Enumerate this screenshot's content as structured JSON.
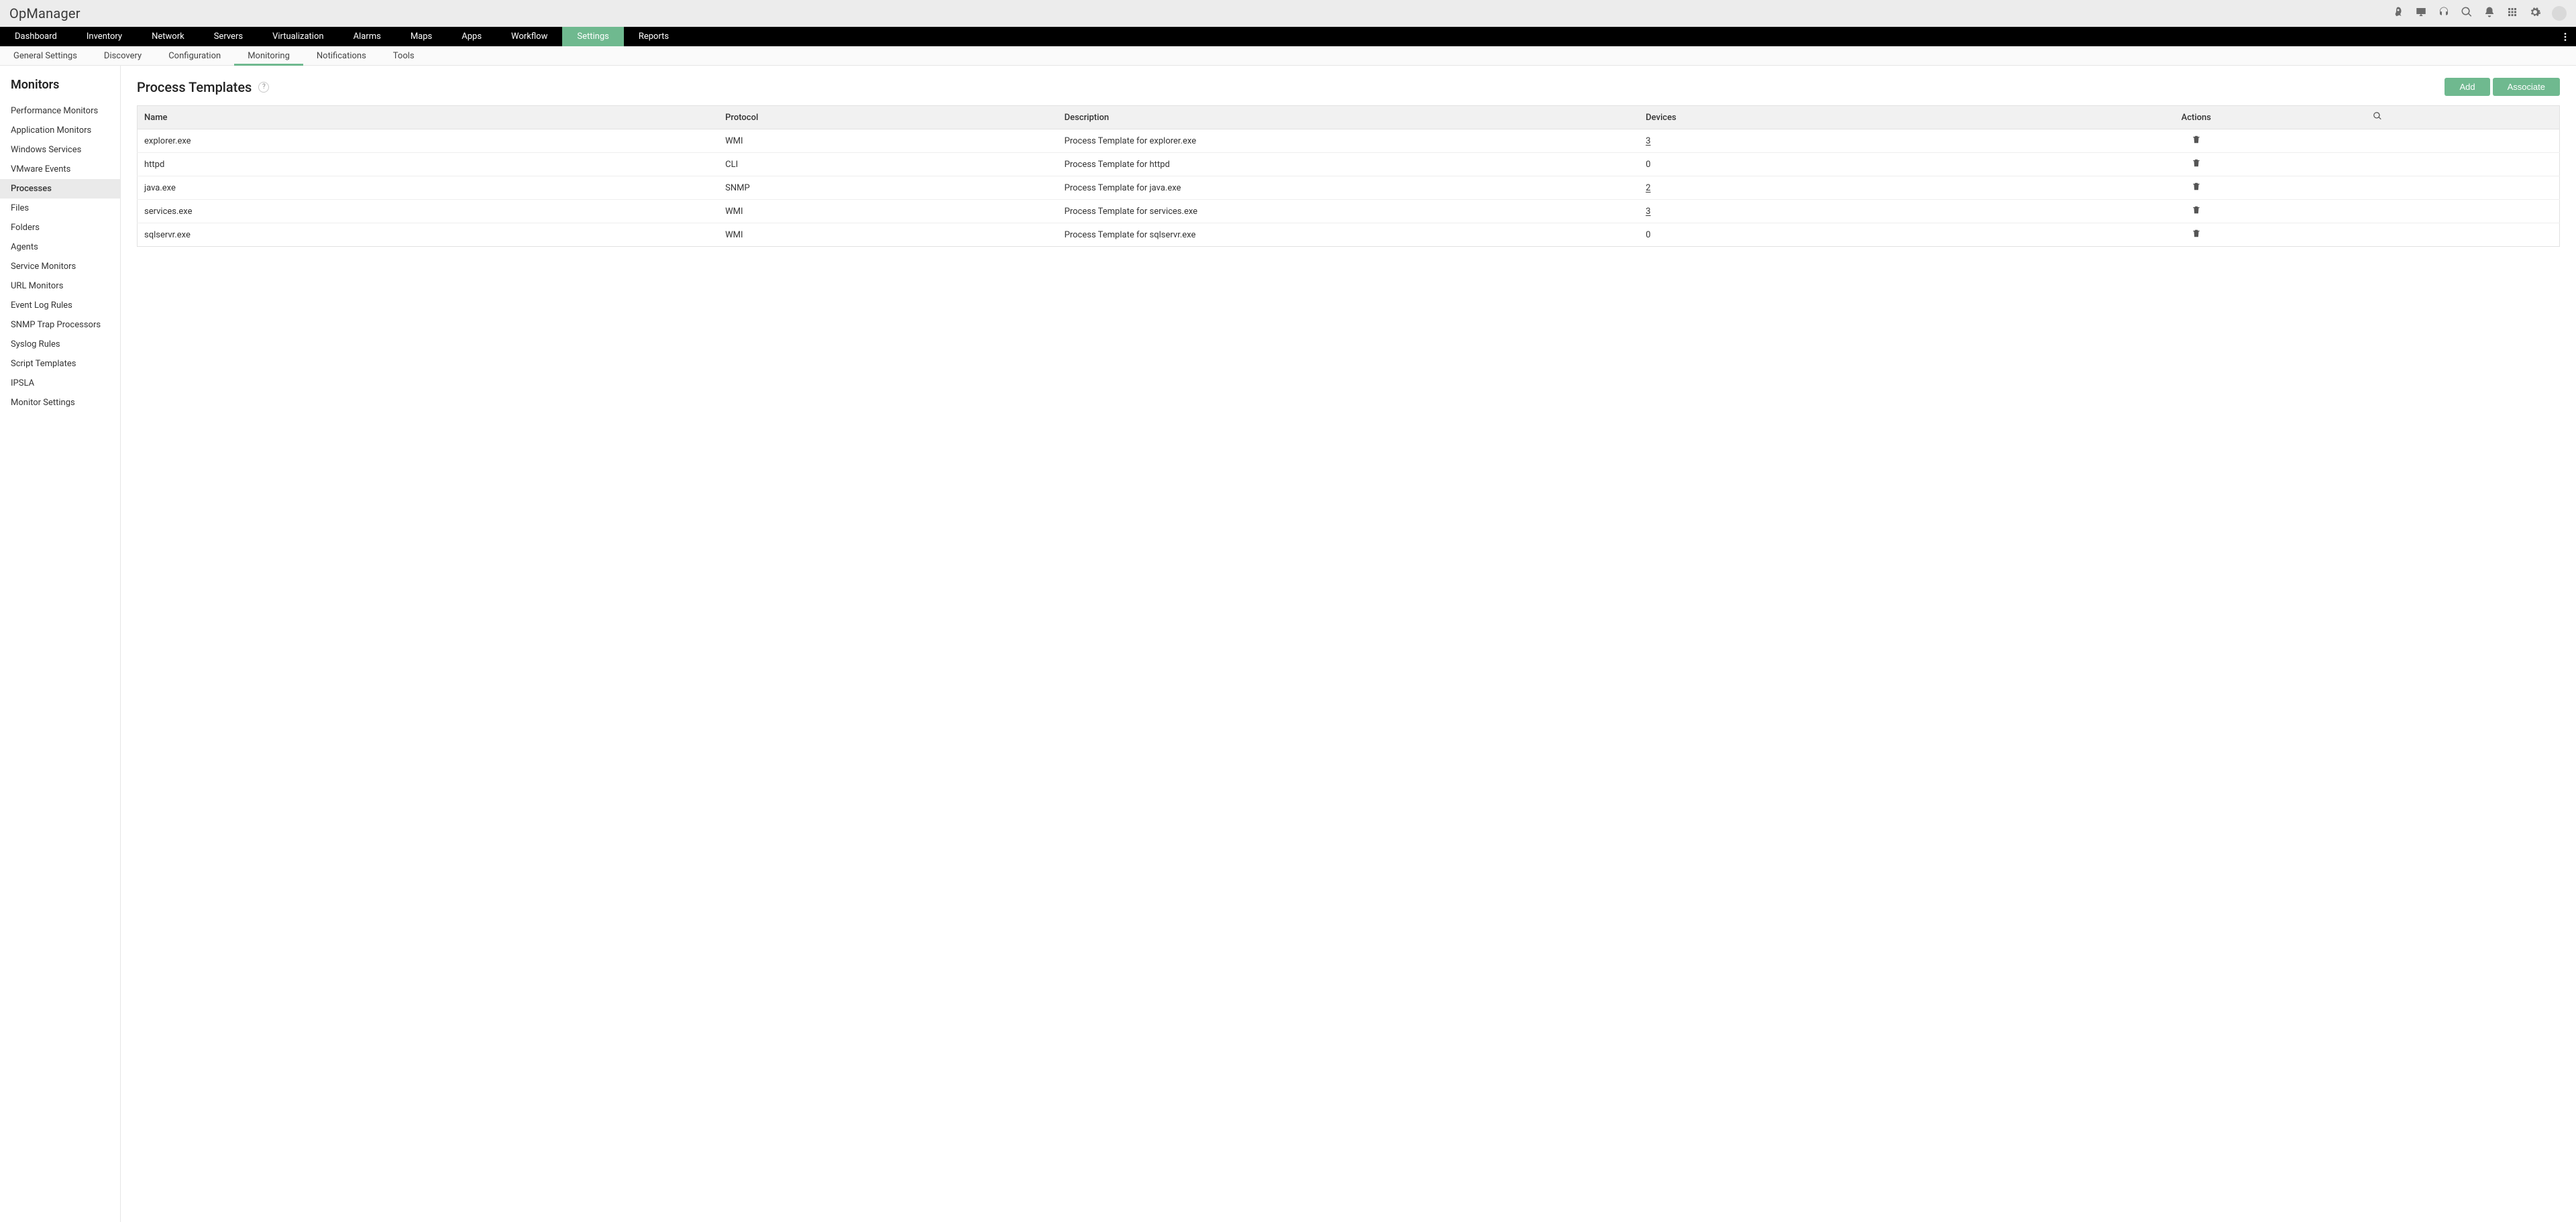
{
  "brand": "OpManager",
  "topIcons": [
    "rocket",
    "monitor",
    "headset",
    "search",
    "bell",
    "apps",
    "gear",
    "avatar"
  ],
  "primaryNav": {
    "items": [
      "Dashboard",
      "Inventory",
      "Network",
      "Servers",
      "Virtualization",
      "Alarms",
      "Maps",
      "Apps",
      "Workflow",
      "Settings",
      "Reports"
    ],
    "activeIndex": 9
  },
  "secondaryNav": {
    "items": [
      "General Settings",
      "Discovery",
      "Configuration",
      "Monitoring",
      "Notifications",
      "Tools"
    ],
    "activeIndex": 3
  },
  "sidebar": {
    "heading": "Monitors",
    "items": [
      "Performance Monitors",
      "Application Monitors",
      "Windows Services",
      "VMware Events",
      "Processes",
      "Files",
      "Folders",
      "Agents",
      "Service Monitors",
      "URL Monitors",
      "Event Log Rules",
      "SNMP Trap Processors",
      "Syslog Rules",
      "Script Templates",
      "IPSLA",
      "Monitor Settings"
    ],
    "activeIndex": 4
  },
  "page": {
    "title": "Process Templates",
    "help": "?",
    "buttons": {
      "add": "Add",
      "associate": "Associate"
    }
  },
  "table": {
    "columns": [
      "Name",
      "Protocol",
      "Description",
      "Devices",
      "Actions"
    ],
    "rows": [
      {
        "name": "explorer.exe",
        "protocol": "WMI",
        "description": "Process Template for explorer.exe",
        "devices": "3",
        "devicesLink": true
      },
      {
        "name": "httpd",
        "protocol": "CLI",
        "description": "Process Template for httpd",
        "devices": "0",
        "devicesLink": false
      },
      {
        "name": "java.exe",
        "protocol": "SNMP",
        "description": "Process Template for java.exe",
        "devices": "2",
        "devicesLink": true
      },
      {
        "name": "services.exe",
        "protocol": "WMI",
        "description": "Process Template for services.exe",
        "devices": "3",
        "devicesLink": true
      },
      {
        "name": "sqlservr.exe",
        "protocol": "WMI",
        "description": "Process Template for sqlservr.exe",
        "devices": "0",
        "devicesLink": false
      }
    ]
  }
}
